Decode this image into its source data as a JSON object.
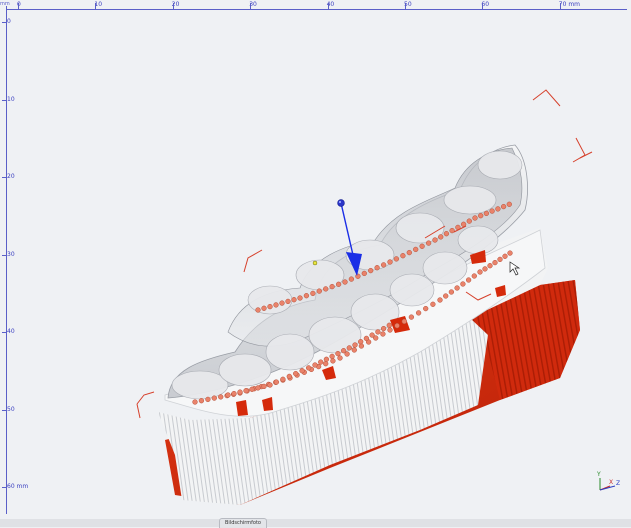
{
  "ruler": {
    "corner_label": "mm",
    "top_ticks": [
      "0",
      "10",
      "20",
      "30",
      "40",
      "50",
      "60",
      "70 mm"
    ],
    "left_ticks": [
      "0",
      "10",
      "20",
      "30",
      "40",
      "50",
      "60 mm"
    ]
  },
  "axis_gizmo": {
    "x": "X",
    "y": "Y",
    "z": "Z"
  },
  "footer": {
    "tab_label": "Bildschirmfoto"
  },
  "colors": {
    "ruler": "#3a3fc0",
    "base_red": "#d32a0c",
    "marker": "#e9826a",
    "insertion_arrow": "#1a2ee6"
  }
}
